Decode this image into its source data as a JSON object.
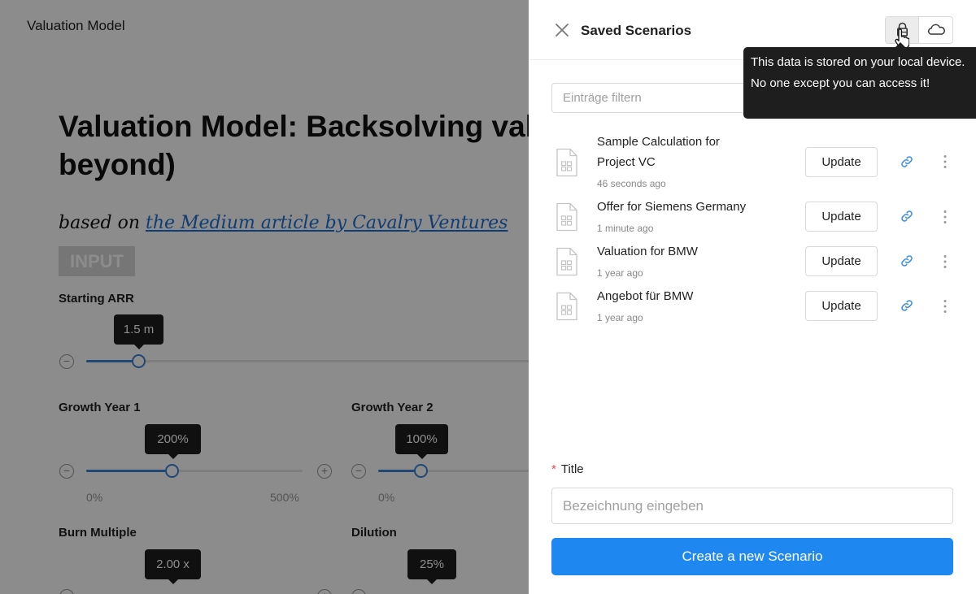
{
  "background": {
    "app_title": "Valuation Model",
    "page_title": "Valuation Model: Backsolving valuation at Series A (and beyond)",
    "subtitle_prefix": "based on ",
    "subtitle_link": "the Medium article by Cavalry Ventures",
    "section_badge": "INPUT",
    "fields": {
      "starting_arr": {
        "label": "Starting ARR",
        "value": "1.5 m"
      },
      "growth_year_1": {
        "label": "Growth Year 1",
        "value": "200%",
        "min": "0%",
        "max": "500%"
      },
      "growth_year_2": {
        "label": "Growth Year 2",
        "value": "100%",
        "min": "0%"
      },
      "burn_multiple": {
        "label": "Burn Multiple",
        "value": "2.00 x"
      },
      "dilution": {
        "label": "Dilution",
        "value": "25%"
      }
    }
  },
  "drawer": {
    "title": "Saved Scenarios",
    "storage_toggle": {
      "selected": "local"
    },
    "storage_popover": "This data is stored on your local device. No one except you can access it!",
    "filter_placeholder": "Einträge filtern",
    "items": [
      {
        "title": "Sample Calculation for Project VC",
        "time": "46 seconds ago",
        "button": "Update"
      },
      {
        "title": "Offer for Siemens Germany",
        "time": "1 minute ago",
        "button": "Update"
      },
      {
        "title": "Valuation for BMW",
        "time": "1 year ago",
        "button": "Update"
      },
      {
        "title": "Angebot für BMW",
        "time": "1 year ago",
        "button": "Update"
      }
    ],
    "title_field": {
      "required_mark": "*",
      "label": "Title",
      "placeholder": "Bezeichnung eingeben"
    },
    "create_button": "Create a new Scenario"
  },
  "colors": {
    "accent": "#1e87f0",
    "link": "#3d8fe0",
    "slider": "#3d82d6",
    "overlay": "rgba(0,0,0,0.45)",
    "tooltip": "#1e1e1e"
  }
}
